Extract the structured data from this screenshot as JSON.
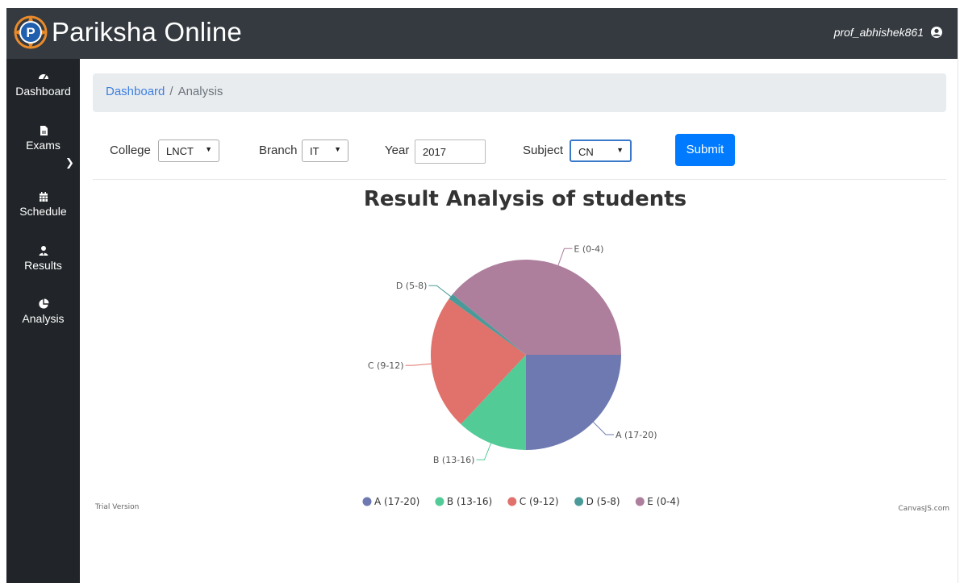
{
  "app": {
    "title": "Pariksha Online",
    "user": "prof_abhishek861"
  },
  "sidebar": {
    "items": [
      {
        "label": "Dashboard",
        "icon": "tachometer-icon"
      },
      {
        "label": "Exams",
        "icon": "file-icon"
      },
      {
        "label": "Schedule",
        "icon": "calendar-icon"
      },
      {
        "label": "Results",
        "icon": "user-tie-icon"
      },
      {
        "label": "Analysis",
        "icon": "pie-chart-icon"
      }
    ]
  },
  "breadcrumb": {
    "home": "Dashboard",
    "sep": "/",
    "current": "Analysis"
  },
  "filters": {
    "college_label": "College",
    "college_value": "LNCT",
    "branch_label": "Branch",
    "branch_value": "IT",
    "year_label": "Year",
    "year_value": "2017",
    "subject_label": "Subject",
    "subject_value": "CN",
    "submit_label": "Submit"
  },
  "chart_footer": {
    "left": "Trial Version",
    "right": "CanvasJS.com"
  },
  "colors": {
    "topbar": "#343a40",
    "sidebar": "#212529",
    "accent": "#007bff"
  },
  "chart_data": {
    "type": "pie",
    "title": "Result Analysis of students",
    "legend_position": "bottom",
    "slices": [
      {
        "label": "A (17-20)",
        "value": 25,
        "color": "#6d79b0"
      },
      {
        "label": "B (13-16)",
        "value": 12,
        "color": "#52cb97"
      },
      {
        "label": "C (9-12)",
        "value": 23,
        "color": "#e0716b"
      },
      {
        "label": "D (5-8)",
        "value": 1,
        "color": "#4b9a9a"
      },
      {
        "label": "E (0-4)",
        "value": 39,
        "color": "#ad7f9c"
      }
    ]
  }
}
